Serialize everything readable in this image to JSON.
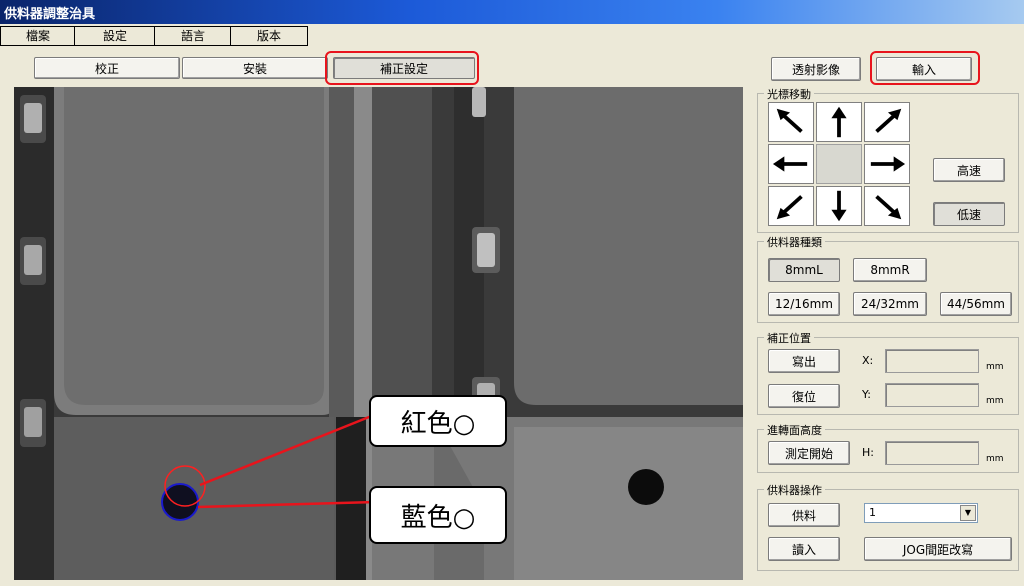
{
  "window": {
    "title": "供料器調整治具"
  },
  "menu": {
    "items": [
      "檔案",
      "設定",
      "語言",
      "版本"
    ]
  },
  "modes": {
    "tabs": [
      "校正",
      "安裝",
      "補正設定"
    ],
    "active": "補正設定"
  },
  "top_buttons": {
    "through_image": "透射影像",
    "input": "輸入"
  },
  "cursor_move": {
    "label": "光標移動",
    "fast": "高速",
    "slow": "低速",
    "arrows": [
      "arrow-up-left-icon",
      "arrow-up-icon",
      "arrow-up-right-icon",
      "arrow-left-icon",
      "arrow-right-icon",
      "arrow-down-left-icon",
      "arrow-down-icon",
      "arrow-down-right-icon"
    ]
  },
  "feeder_type": {
    "label": "供料器種類",
    "options": [
      "8mmL",
      "8mmR",
      "12/16mm",
      "24/32mm",
      "44/56mm"
    ],
    "selected": "8mmL"
  },
  "correction_position": {
    "label": "補正位置",
    "show": "寫出",
    "reset": "復位",
    "x_label": "X:",
    "y_label": "Y:",
    "x_value": "",
    "y_value": "",
    "unit": "mm"
  },
  "height": {
    "label": "進轉面高度",
    "measure": "測定開始",
    "h_label": "H:",
    "h_value": "",
    "unit": "mm"
  },
  "feeder_op": {
    "label": "供料器操作",
    "feed": "供料",
    "read": "讀入",
    "jog": "JOG間距改寫",
    "combo_value": "1"
  },
  "callouts": {
    "red": "紅色○",
    "blue": "藍色○"
  },
  "colors": {
    "highlight": "#e8141c",
    "blue_circle": "#1a1acc",
    "red_circle": "#ff2020"
  }
}
